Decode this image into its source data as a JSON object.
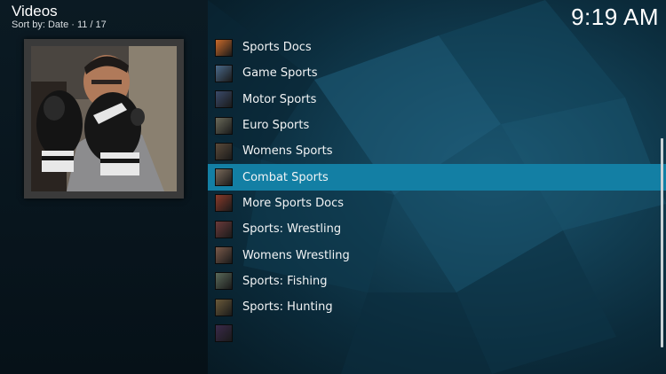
{
  "header": {
    "title": "Videos",
    "subtitle": "Sort by: Date  ·  11 / 17"
  },
  "clock": "9:19 AM",
  "colors": {
    "selection": "#137fa4",
    "left_panel": "#0b1a23",
    "background": "#123f54"
  },
  "poster": {
    "icon": "boxer-poster-image"
  },
  "list": {
    "selected_index": 5,
    "items": [
      {
        "label": "Sports Docs",
        "thumb_color": "#c96a2a"
      },
      {
        "label": "Game Sports",
        "thumb_color": "#4a6a8a"
      },
      {
        "label": "Motor Sports",
        "thumb_color": "#3a4a6a"
      },
      {
        "label": "Euro Sports",
        "thumb_color": "#6a6a5a"
      },
      {
        "label": "Womens Sports",
        "thumb_color": "#5a4a3a"
      },
      {
        "label": "Combat Sports",
        "thumb_color": "#7a6a5a"
      },
      {
        "label": "More Sports Docs",
        "thumb_color": "#8a3a2a"
      },
      {
        "label": "Sports: Wrestling",
        "thumb_color": "#6a3a3a"
      },
      {
        "label": "Womens Wrestling",
        "thumb_color": "#7a5a4a"
      },
      {
        "label": "Sports: Fishing",
        "thumb_color": "#5a6a5a"
      },
      {
        "label": "Sports: Hunting",
        "thumb_color": "#6a5a3a"
      },
      {
        "label": "",
        "thumb_color": "#3a2a4a"
      }
    ]
  }
}
